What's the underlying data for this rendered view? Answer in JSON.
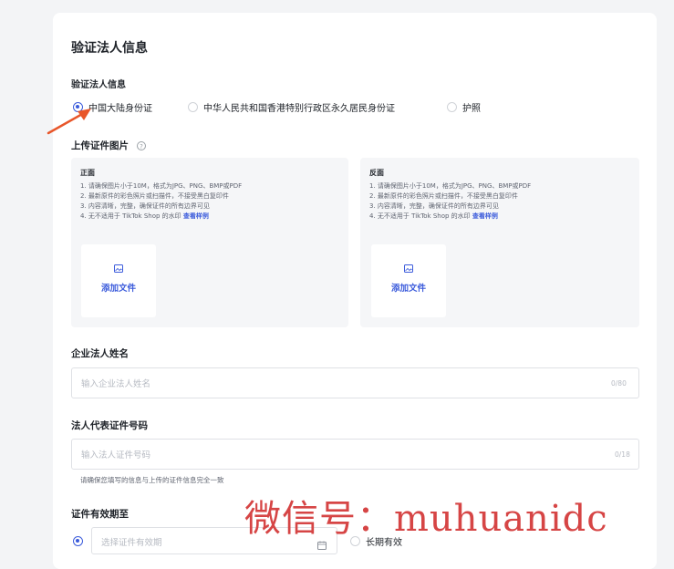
{
  "page": {
    "title": "验证法人信息",
    "section_label": "验证法人信息"
  },
  "id_type": {
    "options": [
      "中国大陆身份证",
      "中华人民共和国香港特别行政区永久居民身份证",
      "护照"
    ],
    "selected_index": 0
  },
  "upload": {
    "label": "上传证件图片",
    "help_icon": "question-circle-icon",
    "front": {
      "title": "正面",
      "rules": [
        "1. 请确保图片小于10M，格式为JPG、PNG、BMP或PDF",
        "2. 最新原件的彩色照片或扫描件，不接受黑白复印件",
        "3. 内容清晰，完整，确保证件的所有边界可见"
      ],
      "rule4_prefix": "4. 无不适用于 TikTok Shop 的水印 ",
      "rule4_link": "查看样例",
      "add_icon": "image-icon",
      "add_label": "添加文件"
    },
    "back": {
      "title": "反面",
      "rules": [
        "1. 请确保图片小于10M，格式为JPG、PNG、BMP或PDF",
        "2. 最新原件的彩色照片或扫描件，不接受黑白复印件",
        "3. 内容清晰，完整，确保证件的所有边界可见"
      ],
      "rule4_prefix": "4. 无不适用于 TikTok Shop 的水印 ",
      "rule4_link": "查看样例",
      "add_icon": "image-icon",
      "add_label": "添加文件"
    }
  },
  "legal_name": {
    "label": "企业法人姓名",
    "placeholder": "输入企业法人姓名",
    "counter": "0/80"
  },
  "id_number": {
    "label": "法人代表证件号码",
    "placeholder": "输入法人证件号码",
    "counter": "0/18",
    "hint": "请确保您填写的信息与上传的证件信息完全一致"
  },
  "validity": {
    "label": "证件有效期至",
    "date_placeholder": "选择证件有效期",
    "calendar_icon": "calendar-icon",
    "long_term_label": "长期有效"
  },
  "overlay": {
    "watermark": "微信号：muhuanidc",
    "arrow_color": "#e8562a"
  },
  "colors": {
    "accent": "#3b5bdb",
    "watermark": "#d64545"
  }
}
